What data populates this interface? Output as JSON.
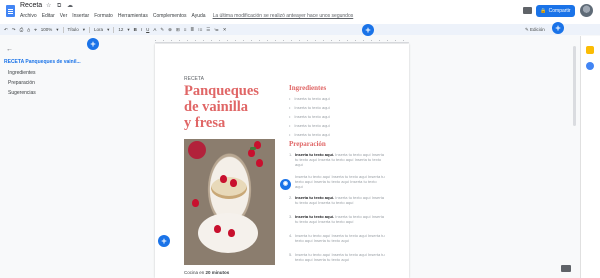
{
  "app": {
    "doc_title": "Receta",
    "title_icons": "☆ ⧉ ☁",
    "menu": [
      "Archivo",
      "Editar",
      "Ver",
      "Insertar",
      "Formato",
      "Herramientas",
      "Complementos",
      "Ayuda"
    ],
    "last_edit": "La última modificación se realizó anteayer hace unos segundos"
  },
  "header": {
    "share_label": "Compartir",
    "share_icon": "lock-icon"
  },
  "toolbar": {
    "items": [
      "↶",
      "↷",
      "⎙",
      "A̲",
      "⌖",
      "100%",
      "▾",
      "Título",
      "▾",
      "Lora",
      "▾",
      "12",
      "▾",
      "B",
      "I",
      "U",
      "A",
      "✎",
      "⊕",
      "⊞",
      "≡",
      "≣",
      "⁝≡",
      "☰",
      "≔",
      "✕"
    ],
    "mode_label": "Edición"
  },
  "outline": {
    "items": [
      {
        "label": "RECETA Panqueques de vainil...",
        "active": true
      },
      {
        "label": "Ingredientes",
        "active": false
      },
      {
        "label": "Preparación",
        "active": false
      },
      {
        "label": "Sugerencias",
        "active": false
      }
    ]
  },
  "document": {
    "kicker": "RECETA",
    "title_lines": [
      "Panqueques",
      "de vainilla",
      "y fresa"
    ],
    "ingredients_heading": "Ingredientes",
    "ingredients": [
      "Inserta tu texto aquí",
      "Inserta tu texto aquí",
      "Inserta tu texto aquí",
      "Inserta tu texto aquí",
      "Inserta tu texto aquí"
    ],
    "preparation_heading": "Preparación",
    "steps": [
      {
        "num": "1.",
        "bold": "Inserta tu texto aquí.",
        "text": " Inserta tu texto aquí Inserta tu texto aquí Inserta tu texto aquí Inserta tu texto aquí"
      },
      {
        "num": "",
        "bold": "",
        "text": "Inserta tu texto aquí Inserta tu texto aquí Inserta tu texto aquí Inserta tu texto aquí Inserta tu texto aquí"
      },
      {
        "num": "2.",
        "bold": "Inserta tu texto aquí.",
        "text": " Inserta tu texto aquí Inserta tu texto aquí Inserta tu texto aquí"
      },
      {
        "num": "3.",
        "bold": "Inserta tu texto aquí.",
        "text": " Inserta tu texto aquí Inserta tu texto aquí Inserta tu texto aquí"
      },
      {
        "num": "4.",
        "text": "Inserta tu texto aquí Inserta tu texto aquí Inserta tu texto aquí Inserta tu texto aquí"
      },
      {
        "num": "5.",
        "text": "Inserta tu texto aquí Inserta tu texto aquí Inserta tu texto aquí Inserta tu texto aquí"
      }
    ],
    "cooking_time_label": "Cocina en",
    "cooking_time_value": "20 minutos"
  },
  "colors": {
    "accent": "#1a73e8",
    "heading": "#e06666",
    "toolbar_bg": "#edf2fa"
  }
}
